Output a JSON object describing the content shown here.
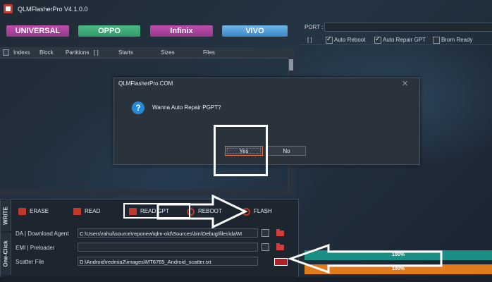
{
  "window": {
    "title": "QLMFlasherPro V4.1.0.0"
  },
  "brands": [
    "UNIVERSAL",
    "OPPO",
    "Infinix",
    "VIVO"
  ],
  "table": {
    "headers": [
      "Indexs",
      "Block",
      "Partitions",
      "[ ]",
      "Starts",
      "Sizes",
      "Files"
    ]
  },
  "right_panel": {
    "port_label": "PORT :",
    "bracket": "[ ]",
    "options": [
      {
        "label": "Auto Reboot",
        "checked": true
      },
      {
        "label": "Auto Repair GPT",
        "checked": true
      },
      {
        "label": "Brom Ready",
        "checked": false
      }
    ]
  },
  "actions": [
    {
      "label": "ERASE",
      "icon": "erase-icon"
    },
    {
      "label": "READ",
      "icon": "read-icon"
    },
    {
      "label": "READ GPT",
      "icon": "read-gpt-icon"
    },
    {
      "label": "REBOOT",
      "icon": "reboot-icon"
    },
    {
      "label": "FLASH",
      "icon": "flash-icon"
    }
  ],
  "side_tabs": {
    "write": "WRITE",
    "one_click": "One-Click"
  },
  "fields": {
    "da_label": "DA | Download Agent",
    "da_value": "C:\\Users\\rahul\\source\\reponew\\qlm-old\\Sources\\bin\\Debug\\files\\da\\M",
    "emi_label": "EMI | Preloader",
    "emi_value": "",
    "scatter_label": "Scatter File",
    "scatter_value": "D:\\Android\\redmia2\\images\\MT6765_Android_scatter.txt"
  },
  "progress": {
    "bar1": "100%",
    "bar2": "100%",
    "bar1_value": 1.0,
    "bar2_value": 1.0
  },
  "dialog": {
    "title": "QLMFlasherPro.COM",
    "message": "Wanna Auto Repair PGPT?",
    "yes": "Yes",
    "no": "No",
    "close_icon": "close-icon"
  },
  "colors": {
    "universal": "#b5459f",
    "oppo": "#3fae78",
    "infinix": "#b5459f",
    "vivo": "#5aa6e0",
    "accent_red": "#c0392b",
    "progress_teal": "#1a8f86",
    "progress_orange": "#e07a1a"
  }
}
